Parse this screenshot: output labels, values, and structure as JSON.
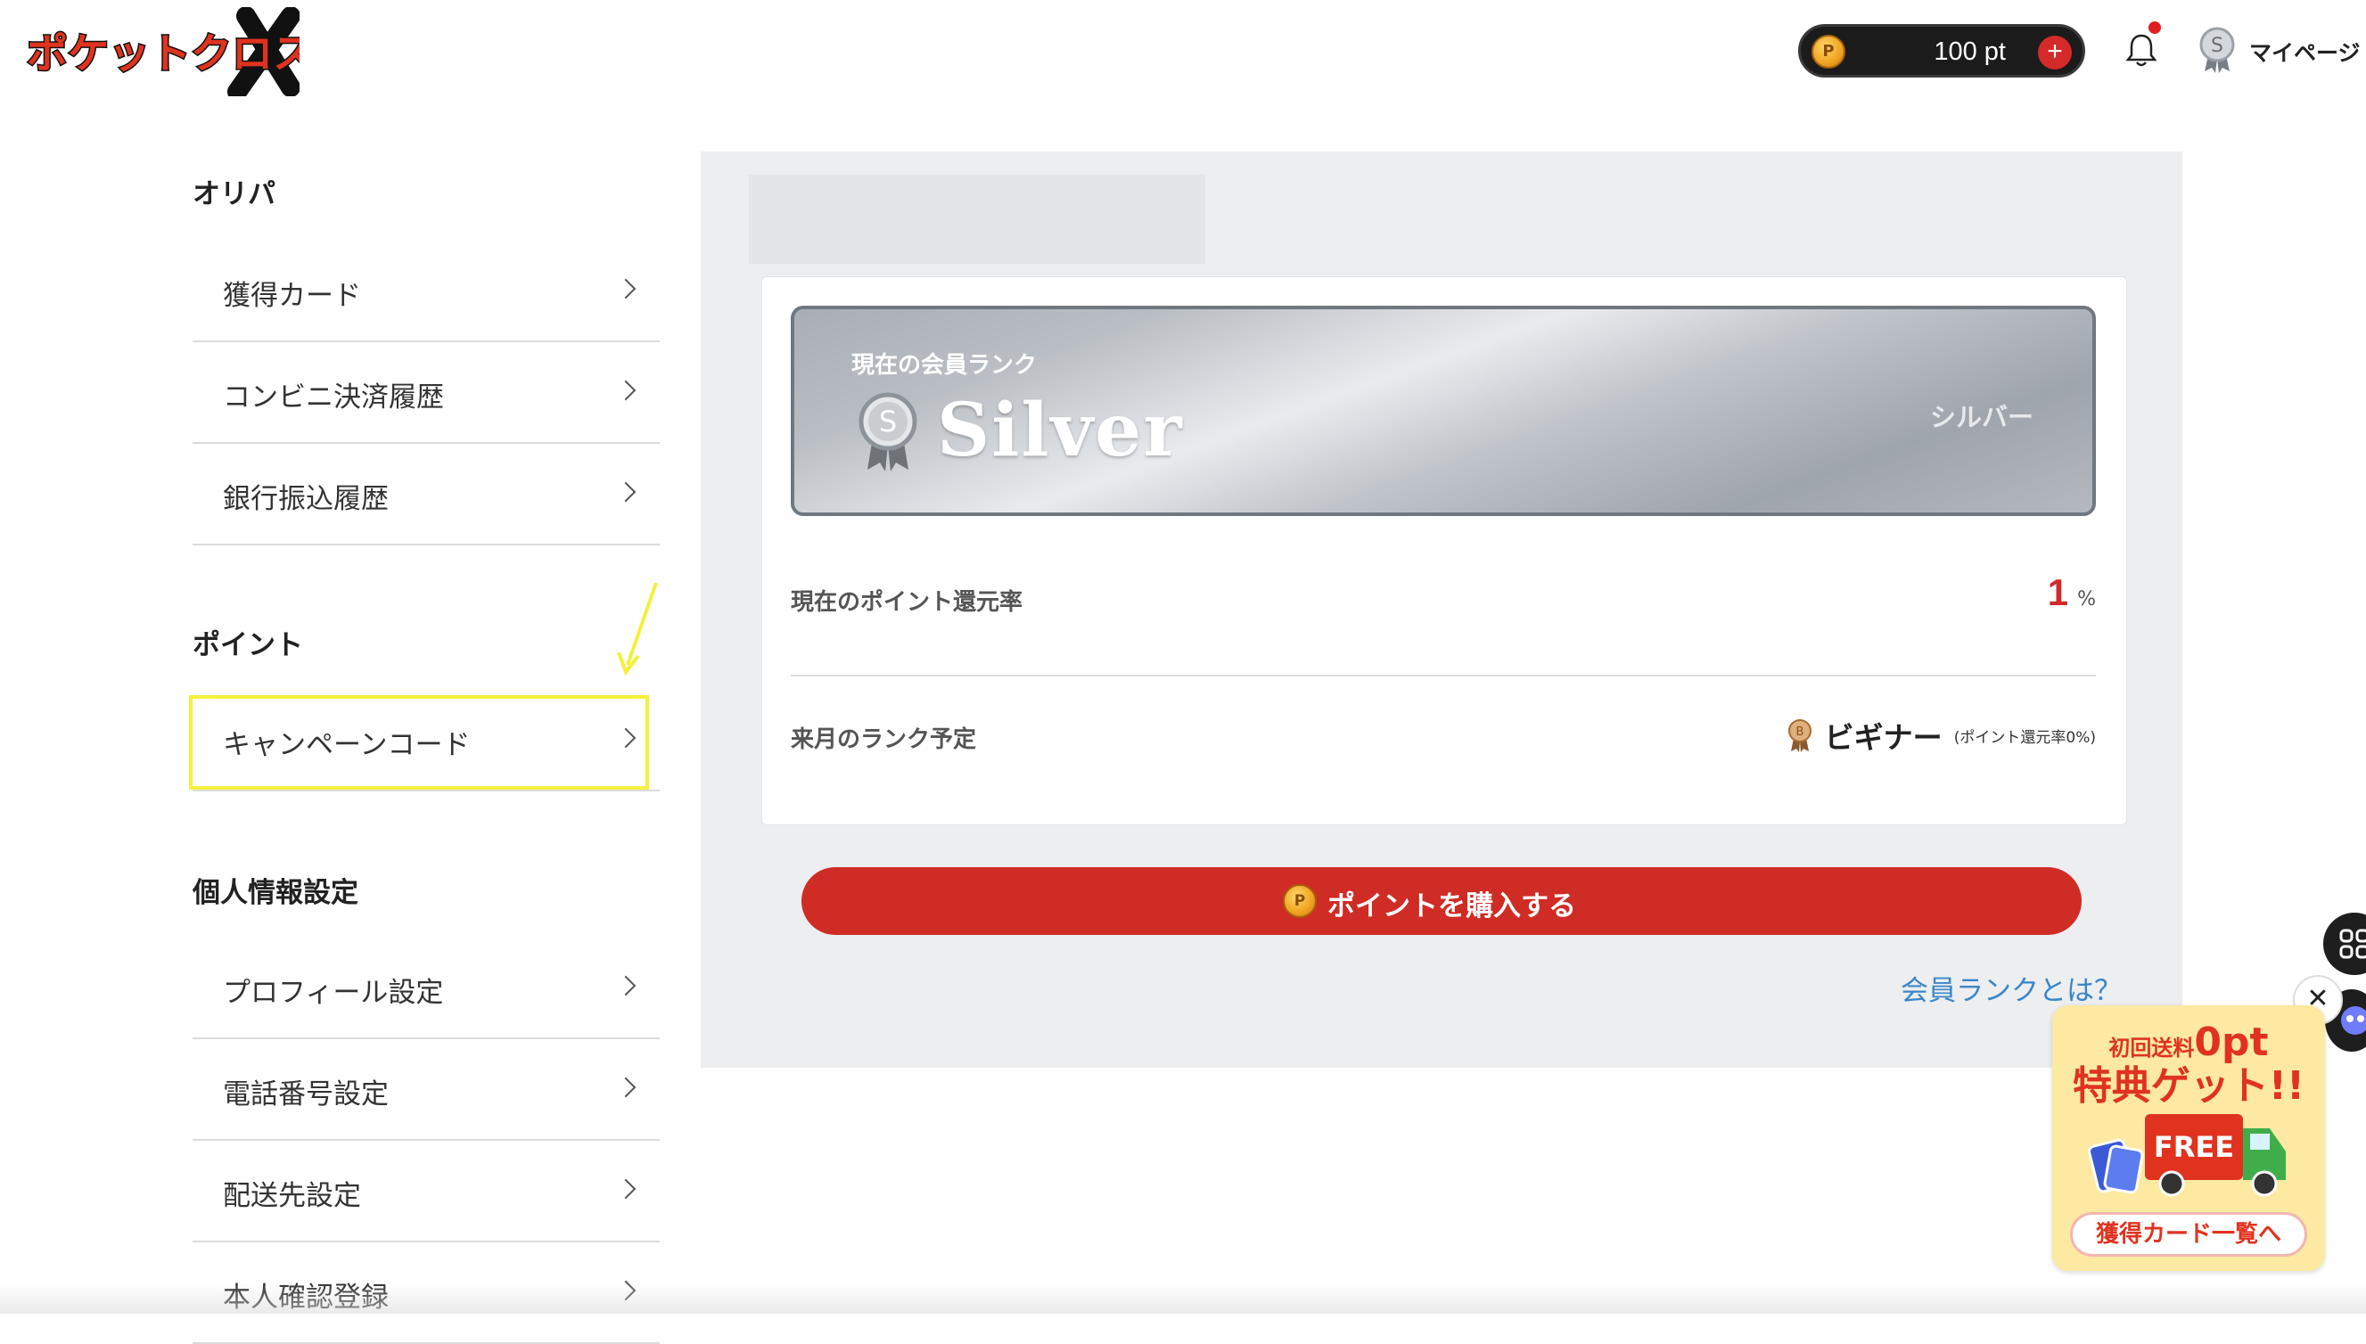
{
  "header": {
    "logo_text": "ポケットクロス",
    "points": {
      "value": "100 pt",
      "coin_symbol": "P",
      "add_symbol": "+"
    },
    "notification": {
      "has_unread": true
    },
    "mypage": {
      "label": "マイページ",
      "badge_letter": "S"
    }
  },
  "sidebar": {
    "sections": [
      {
        "title": "オリパ",
        "items": [
          {
            "label": "獲得カード"
          },
          {
            "label": "コンビニ決済履歴"
          },
          {
            "label": "銀行振込履歴"
          }
        ]
      },
      {
        "title": "ポイント",
        "items": [
          {
            "label": "キャンペーンコード",
            "highlighted": true
          }
        ]
      },
      {
        "title": "個人情報設定",
        "items": [
          {
            "label": "プロフィール設定"
          },
          {
            "label": "電話番号設定"
          },
          {
            "label": "配送先設定"
          },
          {
            "label": "本人確認登録"
          }
        ]
      }
    ]
  },
  "main": {
    "rank_card": {
      "caption": "現在の会員ランク",
      "rank_name": "Silver",
      "rank_kana": "シルバー",
      "medal_letter": "S"
    },
    "point_rate": {
      "label": "現在のポイント還元率",
      "value": "1",
      "unit": "%"
    },
    "next_rank": {
      "label": "来月のランク予定",
      "medal_letter": "B",
      "name": "ビギナー",
      "note": "(ポイント還元率0%)"
    },
    "buy_button": {
      "label": "ポイントを購入する",
      "coin_symbol": "P"
    },
    "rank_info_link": "会員ランクとは？"
  },
  "promo": {
    "line1_small": "初回送料",
    "line1_big": "0pt",
    "line2": "特典ゲット!!",
    "truck_text": "FREE",
    "button": "獲得カード一覧へ"
  },
  "widgets": {
    "close_symbol": "✕"
  },
  "colors": {
    "accent_red": "#cf2c25",
    "link_blue": "#3a86c8",
    "highlight_yellow": "#f5f03a",
    "silver": "#b9bec4"
  }
}
